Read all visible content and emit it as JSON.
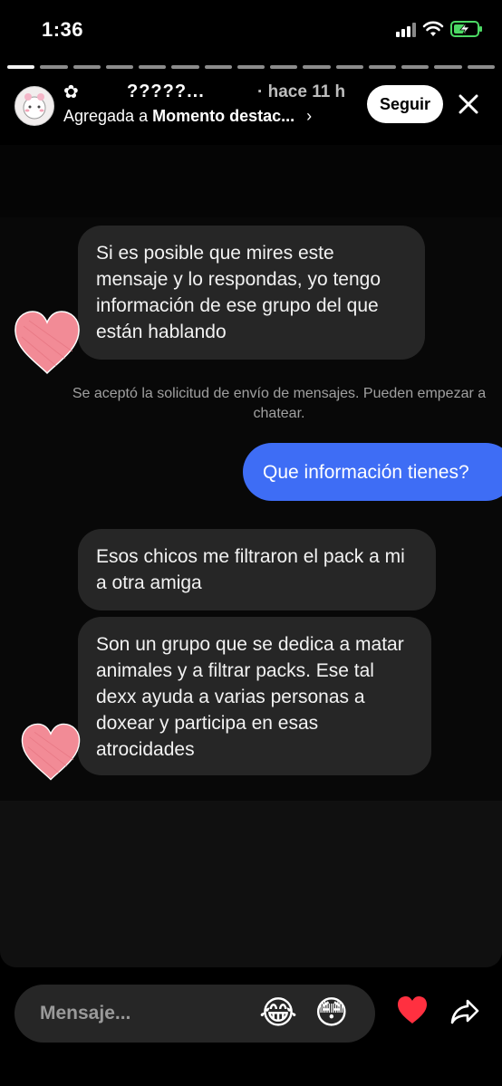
{
  "status_bar": {
    "time": "1:36"
  },
  "header": {
    "username": "?????...",
    "time_ago": "· hace 11 h",
    "highlight_prefix": "Agregada a ",
    "highlight_name": "Momento destac...",
    "chevron": "›",
    "follow_label": "Seguir",
    "icons": {
      "close": "close-icon",
      "flower": "flower-icon"
    }
  },
  "progress": {
    "segments": 15,
    "current_segment": 1
  },
  "chat": {
    "bubble1": "Si es posible que mires este mensaje y lo respondas, yo tengo información de ese grupo del que están hablando",
    "system_message": "Se aceptó la solicitud de envío de mensajes. Pueden empezar a chatear.",
    "bubble2": "Que información tienes?",
    "bubble3": "Esos chicos me filtraron el pack a mi a otra amiga",
    "bubble4": "Son un grupo que se dedica a matar animales y a filtrar packs. Ese tal dexx ayuda a varias personas a doxear y participa en esas atrocidades"
  },
  "footer": {
    "message_placeholder": "Mensaje...",
    "quick_reactions": [
      "😂",
      "😳"
    ],
    "icons": {
      "like": "heart-icon",
      "share": "send-icon"
    }
  },
  "colors": {
    "accent_blue": "#3e6df5",
    "like_red": "#ff3040",
    "bubble_gray": "#262626"
  }
}
